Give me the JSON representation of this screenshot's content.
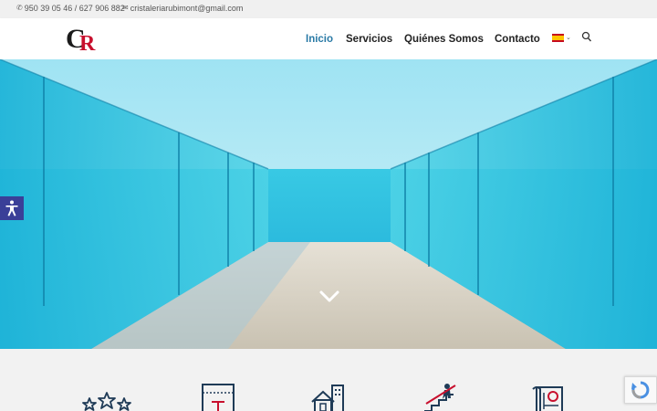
{
  "topbar": {
    "phone": "950 39 05 46 / 627 906 882",
    "email": "cristaleriarubimont@gmail.com",
    "phone_icon": "phone-icon",
    "email_icon": "envelope-icon"
  },
  "header": {
    "logo_text": "CR",
    "nav": [
      "Inicio",
      "Servicios",
      "Quiénes Somos",
      "Contacto"
    ],
    "active_nav": "Inicio",
    "language_icon": "spain-flag-icon",
    "search_icon": "search-icon"
  },
  "hero": {
    "accessibility_icon": "accessibility-icon",
    "scroll_icon": "chevron-down-icon"
  },
  "services": {
    "icons": [
      "stars-icon",
      "glass-panel-icon",
      "house-building-icon",
      "stairs-railing-icon",
      "blueprint-icon"
    ]
  },
  "recaptcha_icon": "recaptcha-icon",
  "colors": {
    "accent": "#2a7aa6",
    "nav_text": "#222222",
    "accessibility_bg": "#3a3f98",
    "services_bg": "#f2f2f2",
    "icon_stroke": "#1f3b57",
    "icon_accent": "#c8102e"
  }
}
